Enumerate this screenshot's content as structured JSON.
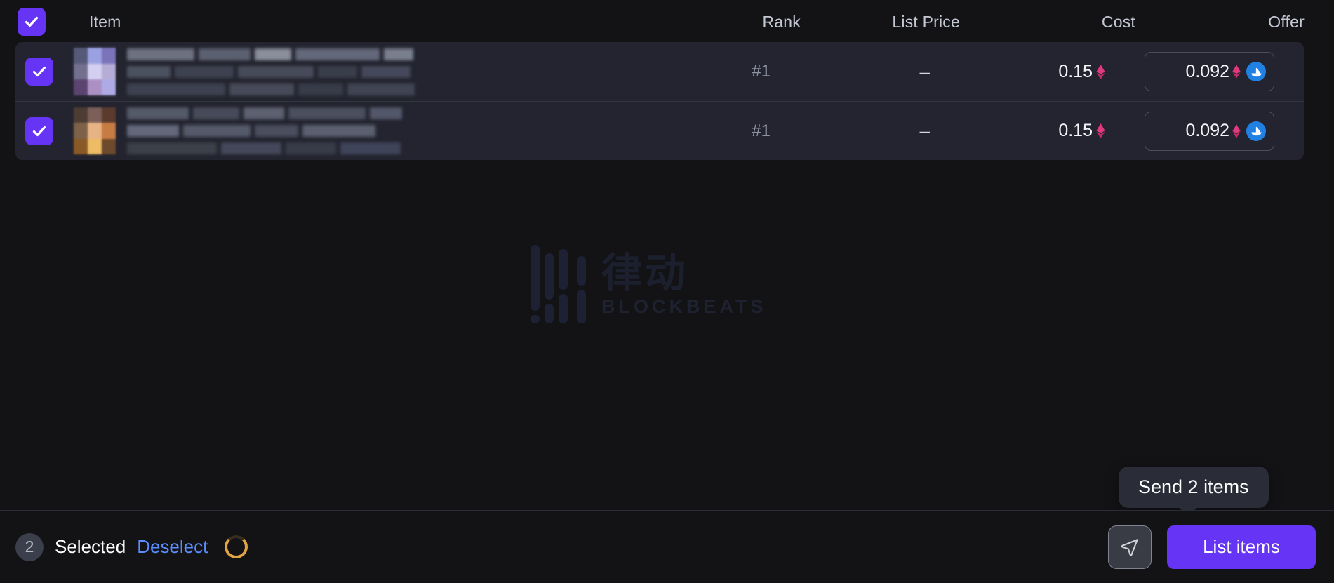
{
  "table": {
    "columns": [
      {
        "key": "check",
        "label": ""
      },
      {
        "key": "item",
        "label": "Item"
      },
      {
        "key": "rank",
        "label": "Rank"
      },
      {
        "key": "list_price",
        "label": "List Price"
      },
      {
        "key": "cost",
        "label": "Cost"
      },
      {
        "key": "offer",
        "label": "Offer"
      }
    ],
    "header_checkbox_checked": true,
    "rows": [
      {
        "checked": true,
        "item_name": "",
        "item_redacted": true,
        "rank": "#1",
        "list_price": "–",
        "cost": "0.15",
        "cost_currency_icon": "ethereum-icon",
        "offer": "0.092",
        "offer_currency_icon": "ethereum-icon",
        "offer_marketplace_icon": "opensea-icon"
      },
      {
        "checked": true,
        "item_name": "",
        "item_redacted": true,
        "rank": "#1",
        "list_price": "–",
        "cost": "0.15",
        "cost_currency_icon": "ethereum-icon",
        "offer": "0.092",
        "offer_currency_icon": "ethereum-icon",
        "offer_marketplace_icon": "opensea-icon"
      }
    ]
  },
  "watermark": {
    "cn_text": "律动",
    "en_text": "BLOCKBEATS"
  },
  "tooltip": {
    "text": "Send 2 items"
  },
  "bottom_bar": {
    "selected_count": "2",
    "selected_label": "Selected",
    "deselect_label": "Deselect",
    "loading_icon": "spinner-icon",
    "send_icon": "send-paper-plane-icon",
    "list_items_label": "List items"
  },
  "colors": {
    "accent_purple": "#6534f5",
    "link_blue": "#5b8dff",
    "opensea_blue": "#2081e2",
    "ethereum_pink": "#e0397f",
    "spinner_orange": "#e3a343",
    "page_background": "#131316",
    "row_background": "#23242f"
  }
}
